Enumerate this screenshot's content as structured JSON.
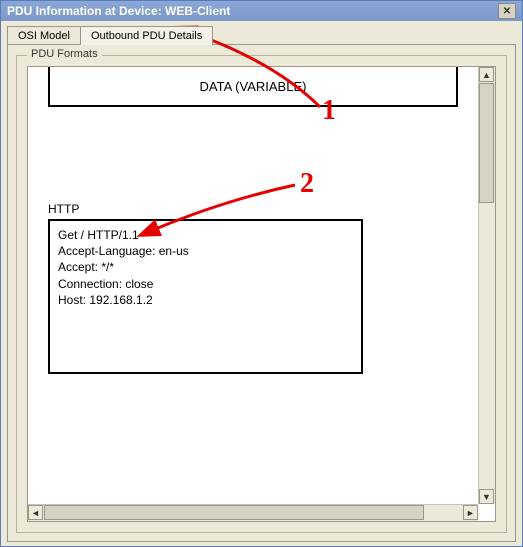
{
  "window": {
    "title": "PDU Information at Device: WEB-Client"
  },
  "tabs": {
    "osi": "OSI Model",
    "outbound": "Outbound PDU Details"
  },
  "fieldset": {
    "legend": "PDU Formats"
  },
  "data_box": {
    "label": "DATA (VARIABLE)"
  },
  "http": {
    "label": "HTTP",
    "lines": {
      "l1": "Get / HTTP/1.1",
      "l2": "Accept-Language:  en-us",
      "l3": "Accept:  */*",
      "l4": "Connection: close",
      "l5": "Host: 192.168.1.2"
    }
  },
  "annotations": {
    "n1": "1",
    "n2": "2"
  },
  "colors": {
    "annotation": "#e50000"
  }
}
